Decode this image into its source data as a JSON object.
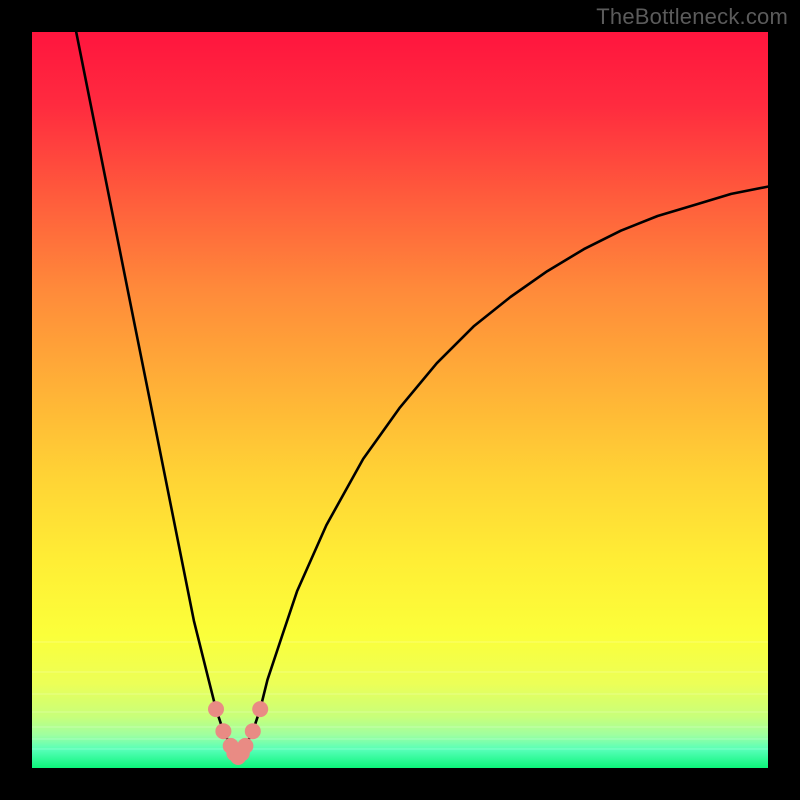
{
  "watermark": "TheBottleneck.com",
  "colors": {
    "marker_fill": "#e98b84",
    "marker_stroke": "#b8433c",
    "curve_stroke": "#000000"
  },
  "chart_data": {
    "type": "line",
    "title": "",
    "xlabel": "",
    "ylabel": "",
    "xlim": [
      0,
      100
    ],
    "ylim": [
      0,
      100
    ],
    "grid": false,
    "x": [
      6,
      8,
      10,
      12,
      14,
      16,
      18,
      20,
      22,
      24,
      25,
      26,
      27,
      27.5,
      28,
      28.5,
      29,
      30,
      31,
      32,
      34,
      36,
      40,
      45,
      50,
      55,
      60,
      65,
      70,
      75,
      80,
      85,
      90,
      95,
      100
    ],
    "values": [
      100,
      90,
      80,
      70,
      60,
      50,
      40,
      30,
      20,
      12,
      8,
      5,
      3,
      2,
      1.5,
      2,
      3,
      5,
      8,
      12,
      18,
      24,
      33,
      42,
      49,
      55,
      60,
      64,
      67.5,
      70.5,
      73,
      75,
      76.5,
      78,
      79
    ],
    "valley_markers_x": [
      25,
      26,
      27,
      27.5,
      28,
      28.5,
      29,
      30,
      31
    ],
    "valley_markers_y": [
      8,
      5,
      3,
      2,
      1.5,
      2,
      3,
      5,
      8
    ],
    "annotations": []
  }
}
